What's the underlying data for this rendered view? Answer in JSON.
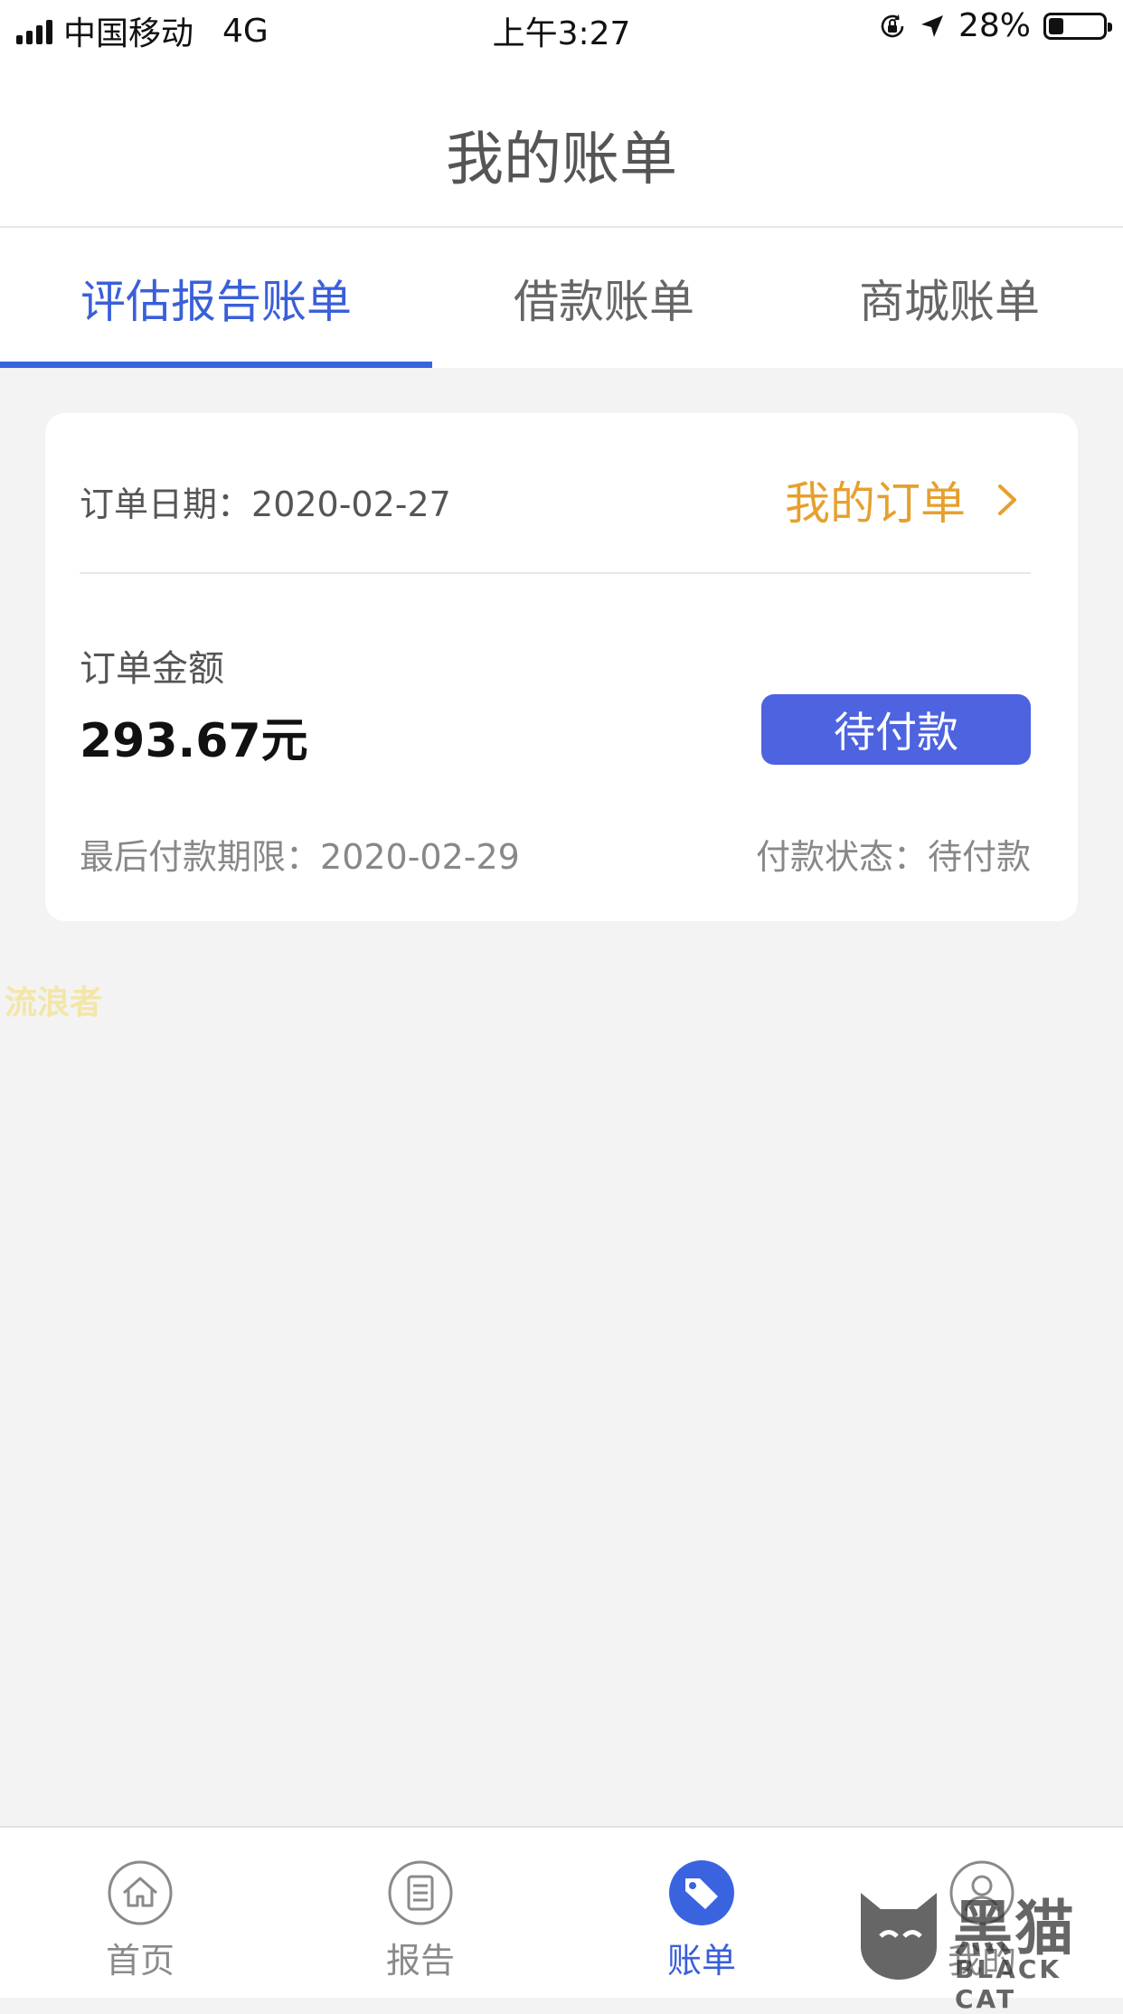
{
  "status_bar": {
    "carrier": "中国移动",
    "network": "4G",
    "time": "上午3:27",
    "battery": "28%",
    "battery_level": 0.28
  },
  "header": {
    "title": "我的账单"
  },
  "tabs": [
    {
      "label": "评估报告账单",
      "active": true
    },
    {
      "label": "借款账单",
      "active": false
    },
    {
      "label": "商城账单",
      "active": false
    }
  ],
  "bill_card": {
    "order_date_label": "订单日期：",
    "order_date": "2020-02-27",
    "my_order_link": "我的订单",
    "amount_label": "订单金额",
    "amount": "293.67元",
    "pay_button": "待付款",
    "deadline_label": "最后付款期限：",
    "deadline": "2020-02-29",
    "payment_status_label": "付款状态：",
    "payment_status": "待付款"
  },
  "watermark_text": "流浪者",
  "bottom_nav": [
    {
      "label": "首页",
      "icon": "home-icon",
      "active": false
    },
    {
      "label": "报告",
      "icon": "report-icon",
      "active": false
    },
    {
      "label": "账单",
      "icon": "bill-tag-icon",
      "active": true
    },
    {
      "label": "我的",
      "icon": "profile-icon",
      "active": false
    }
  ],
  "logo": {
    "text_cn": "黑猫",
    "text_en": "BLACK CAT"
  },
  "colors": {
    "accent": "#3a5fd9",
    "button": "#4d63e0",
    "link_orange": "#e6a02e",
    "background": "#f3f3f3"
  }
}
